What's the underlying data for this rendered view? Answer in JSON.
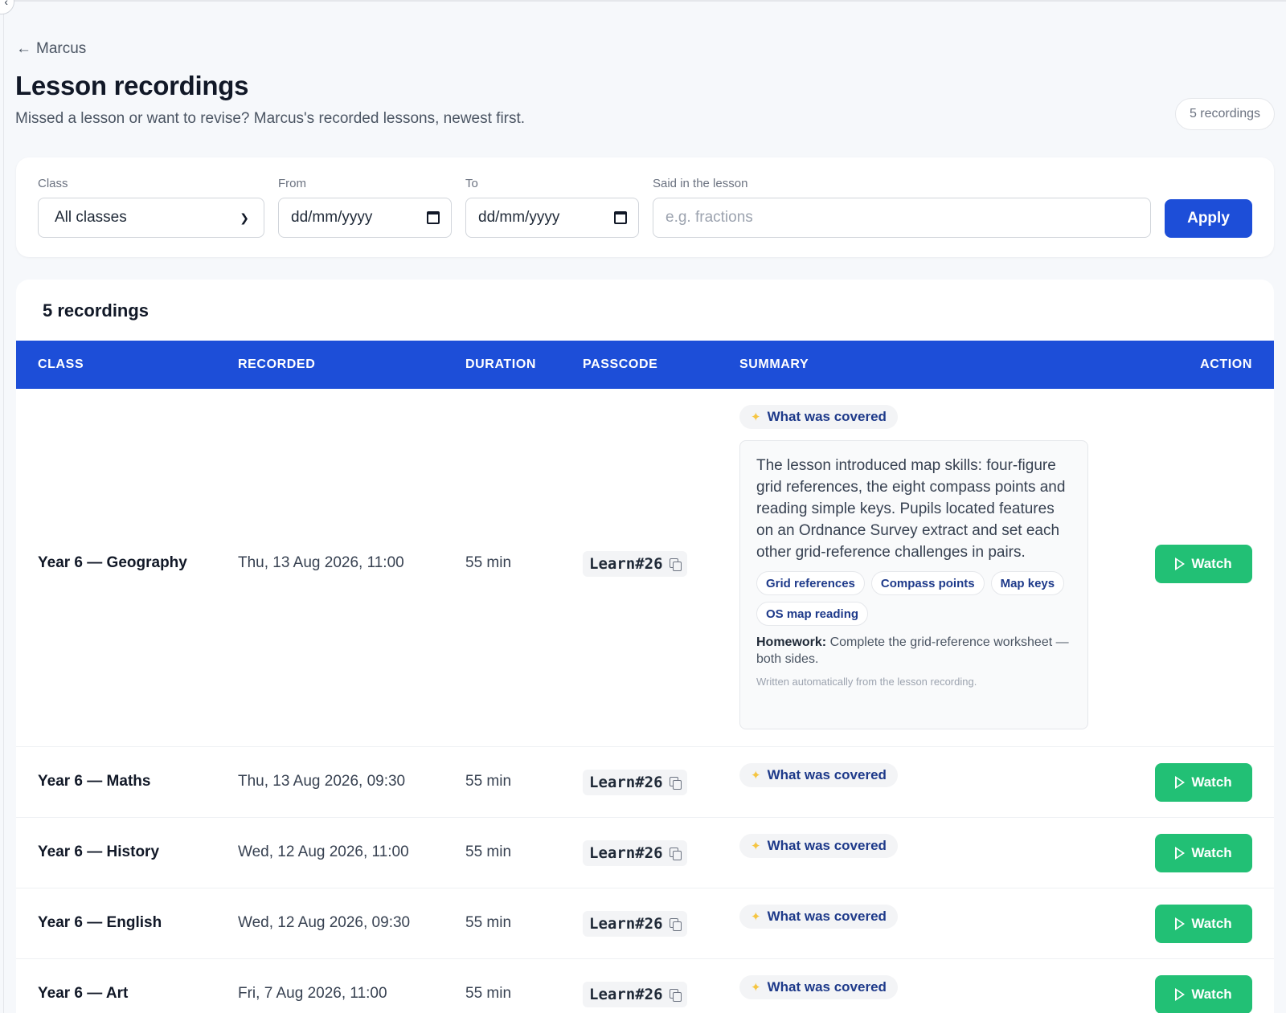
{
  "nav": {
    "back_label": "Marcus",
    "back_icon": "arrow-left-icon",
    "collapse_icon": "chevron-left-icon"
  },
  "header": {
    "title": "Lesson recordings",
    "subtitle": "Missed a lesson or want to revise? Marcus's recorded lessons, newest first.",
    "count_badge": "5 recordings"
  },
  "filters": {
    "class_label": "Class",
    "class_value": "All classes",
    "from_label": "From",
    "from_value": "dd/mm/yyyy",
    "to_label": "To",
    "to_value": "dd/mm/yyyy",
    "search_label": "Said in the lesson",
    "search_placeholder": "e.g. fractions",
    "apply_label": "Apply"
  },
  "table": {
    "title": "5 recordings",
    "columns": [
      "CLASS",
      "RECORDED",
      "DURATION",
      "PASSCODE",
      "SUMMARY",
      "ACTION"
    ],
    "covered_label": "What was covered",
    "watch_label": "Watch",
    "rows": [
      {
        "class": "Year 6 — Geography",
        "recorded": "Thu, 13 Aug 2026, 11:00",
        "duration": "55 min",
        "passcode": "Learn#26",
        "expanded": true,
        "summary": "The lesson introduced map skills: four-figure grid references, the eight compass points and reading simple keys. Pupils located features on an Ordnance Survey extract and set each other grid-reference challenges in pairs.",
        "tags": [
          "Grid references",
          "Compass points",
          "Map keys",
          "OS map reading"
        ],
        "homework_label": "Homework:",
        "homework": "Complete the grid-reference worksheet — both sides.",
        "auto_note": "Written automatically from the lesson recording."
      },
      {
        "class": "Year 6 — Maths",
        "recorded": "Thu, 13 Aug 2026, 09:30",
        "duration": "55 min",
        "passcode": "Learn#26"
      },
      {
        "class": "Year 6 — History",
        "recorded": "Wed, 12 Aug 2026, 11:00",
        "duration": "55 min",
        "passcode": "Learn#26"
      },
      {
        "class": "Year 6 — English",
        "recorded": "Wed, 12 Aug 2026, 09:30",
        "duration": "55 min",
        "passcode": "Learn#26"
      },
      {
        "class": "Year 6 — Art",
        "recorded": "Fri, 7 Aug 2026, 11:00",
        "duration": "55 min",
        "passcode": "Learn#26"
      }
    ]
  },
  "colors": {
    "primary": "#1d4ed8",
    "watch": "#22c075",
    "covered_text": "#1e3a8a"
  }
}
